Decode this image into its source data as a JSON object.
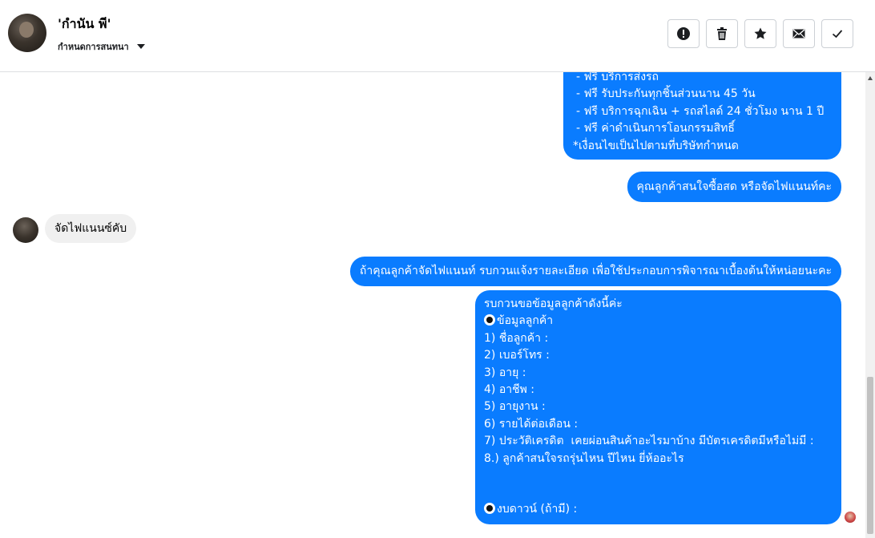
{
  "header": {
    "contact_name": "'กำนัน พี'",
    "settings_label": "กำหนดการสนทนา"
  },
  "toolbar": {
    "buttons": [
      {
        "name": "mark-spam",
        "icon": "alert-circle-icon"
      },
      {
        "name": "delete",
        "icon": "trash-icon"
      },
      {
        "name": "star",
        "icon": "star-icon"
      },
      {
        "name": "mark-unread",
        "icon": "envelope-icon"
      },
      {
        "name": "mark-done",
        "icon": "check-icon"
      }
    ]
  },
  "messages": {
    "promo_lines": [
      "- ฟรี บริการส่งรถ",
      "- ฟรี รับประกันทุกชิ้นส่วนนาน 45 วัน",
      "- ฟรี บริการฉุกเฉิน + รถสไลด์ 24 ชั่วโมง นาน 1 ปี",
      "- ฟรี ค่าดำเนินการโอนกรรมสิทธิ์",
      "*เงื่อนไขเป็นไปตามที่บริษัทกำหนด"
    ],
    "ask_payment": "คุณลูกค้าสนใจซื้อสด หรือจัดไฟแนนท์คะ",
    "reply_finance": "จัดไฟแนนซ์คับ",
    "request_details": "ถ้าคุณลูกค้าจัดไฟแนนท์ รบกวนแจ้งรายละเอียด เพื่อใช้ประกอบการพิจารณาเบื้องต้นให้หน่อยนะคะ",
    "form_intro": "รบกวนขอข้อมูลลูกค้าดังนี้ค่ะ",
    "form_section": "ข้อมูลลูกค้า",
    "form_fields": [
      "1) ชื่อลูกค้า :",
      "2) เบอร์โทร :",
      "3) อายุ :",
      "4) อาชีพ :",
      "5) อายุงาน :",
      "6) รายได้ต่อเดือน :",
      "7) ประวัติเครดิต  เคยผ่อนสินค้าอะไรมาบ้าง มีบัตรเครดิตมีหรือไม่มี :",
      "8.) ลูกค้าสนใจรถรุ่นไหน ปีไหน ยี่ห้ออะไร"
    ],
    "form_down": "งบดาวน์ (ถ้ามี) :"
  },
  "colors": {
    "outgoing_bubble": "#0a7cff",
    "incoming_bubble": "#f0f0f0"
  }
}
